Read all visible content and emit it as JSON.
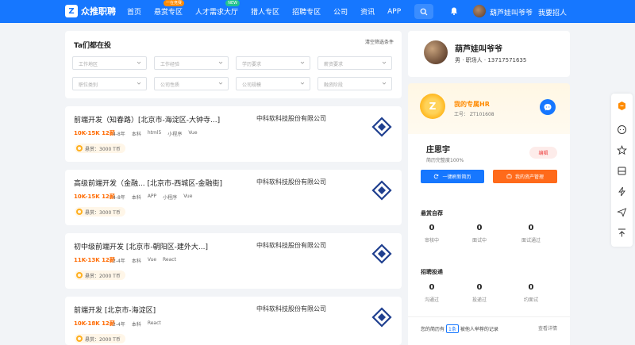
{
  "brand": {
    "name": "众推职聘"
  },
  "nav": {
    "items": [
      {
        "label": "首页"
      },
      {
        "label": "悬赏专区",
        "badge": "一在竞赛",
        "badge_color": "#ff8a00"
      },
      {
        "label": "人才需求大厅",
        "badge": "NEW",
        "badge_color": "#22c38e"
      },
      {
        "label": "猎人专区"
      },
      {
        "label": "招聘专区"
      },
      {
        "label": "公司"
      },
      {
        "label": "资讯"
      },
      {
        "label": "APP"
      }
    ],
    "user_name": "葫芦娃叫爷爷",
    "hire_label": "我要招人"
  },
  "filters": {
    "title": "Ta们都在投",
    "clear_label": "清空筛选条件",
    "row1": [
      "工作地区",
      "工作经验",
      "学历要求",
      "薪资要求"
    ],
    "row2": [
      "职位类别",
      "公司性质",
      "公司规模",
      "融资阶段"
    ]
  },
  "jobs": [
    {
      "title": "前端开发（知春路）[北京市-海淀区-大钟寺...]",
      "company": "中科软科技股份有限公司",
      "salary": "10K-15K 12薪",
      "tags": [
        "4-8年",
        "本科",
        "html5",
        "小程序",
        "Vue"
      ],
      "bonus": "悬赏：3000 T币"
    },
    {
      "title": "高级前端开发（金融... [北京市-西城区-金融街]",
      "company": "中科软科技股份有限公司",
      "salary": "10K-15K 12薪",
      "tags": [
        "4-8年",
        "本科",
        "APP",
        "小程序",
        "Vue"
      ],
      "bonus": "悬赏：3000 T币"
    },
    {
      "title": "初中级前端开发 [北京市-朝阳区-建外大...]",
      "company": "中科软科技股份有限公司",
      "salary": "11K-13K 12薪",
      "tags": [
        "2-4年",
        "本科",
        "Vue",
        "React"
      ],
      "bonus": "悬赏：2000 T币"
    },
    {
      "title": "前端开发 [北京市-海淀区]",
      "company": "中科软科技股份有限公司",
      "salary": "10K-18K 12薪",
      "tags": [
        "2-4年",
        "本科",
        "React"
      ],
      "bonus": "悬赏：2000 T币"
    }
  ],
  "profile": {
    "name": "葫芦娃叫爷爷",
    "info": "男 · 职场人 · 13717571635"
  },
  "hr": {
    "title": "我的专属HR",
    "id": "工号： ZT101608"
  },
  "mine": {
    "name": "庄思宇",
    "completeness": "简历完整度100%",
    "edit_label": "编辑",
    "refresh_label": "一键刷新简历",
    "assets_label": "我的资产管理"
  },
  "reward_stats": {
    "title": "悬赏自荐",
    "items": [
      {
        "value": "0",
        "label": "审核中"
      },
      {
        "value": "0",
        "label": "面试中"
      },
      {
        "value": "0",
        "label": "面试通过"
      }
    ]
  },
  "delivery_stats": {
    "title": "招聘投递",
    "items": [
      {
        "value": "0",
        "label": "沟通过"
      },
      {
        "value": "0",
        "label": "投递过"
      },
      {
        "value": "0",
        "label": "约面试"
      }
    ]
  },
  "resume_bar": {
    "prefix": "您的简历有",
    "count": "1条",
    "suffix": "被他人举荐的记录",
    "link": "查看详情"
  },
  "colors": {
    "primary": "#1677ff",
    "accent": "#ff6a00",
    "hr_gold": "#ff8a00"
  }
}
